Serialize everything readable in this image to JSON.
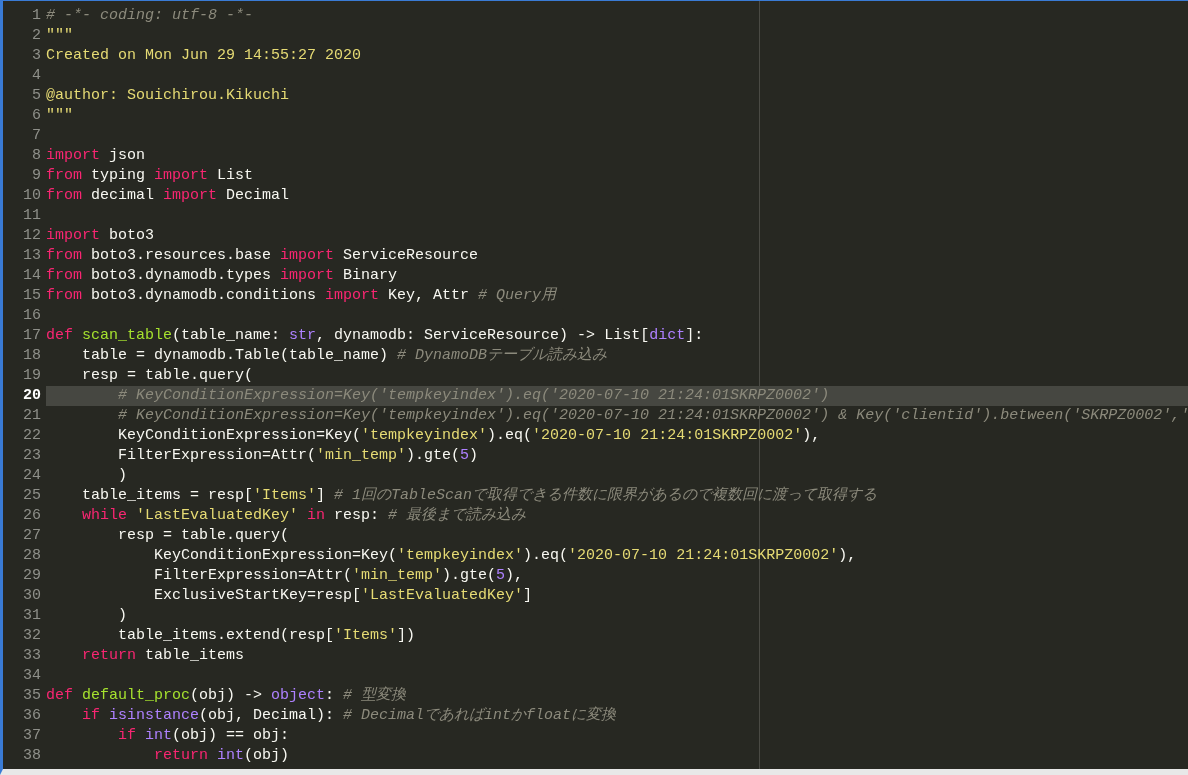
{
  "editor": {
    "lines": [
      {
        "number": "1",
        "current": false,
        "tokens": [
          {
            "kind": "comment",
            "text": "# -*- coding: utf-8 -*-"
          }
        ]
      },
      {
        "number": "2",
        "current": false,
        "tokens": [
          {
            "kind": "string",
            "text": "\"\"\""
          }
        ]
      },
      {
        "number": "3",
        "current": false,
        "tokens": [
          {
            "kind": "string",
            "text": "Created on Mon Jun 29 14:55:27 2020"
          }
        ]
      },
      {
        "number": "4",
        "current": false
      },
      {
        "number": "5",
        "current": false,
        "tokens": [
          {
            "kind": "string",
            "text": "@author: Souichirou.Kikuchi"
          }
        ]
      },
      {
        "number": "6",
        "current": false,
        "tokens": [
          {
            "kind": "string",
            "text": "\"\"\""
          }
        ]
      },
      {
        "number": "7",
        "current": false
      },
      {
        "number": "8",
        "current": false,
        "tokens": [
          {
            "kind": "keyword",
            "text": "import"
          },
          {
            "kind": "plain",
            "text": " json"
          }
        ]
      },
      {
        "number": "9",
        "current": false,
        "tokens": [
          {
            "kind": "keyword",
            "text": "from"
          },
          {
            "kind": "plain",
            "text": " typing "
          },
          {
            "kind": "keyword",
            "text": "import"
          },
          {
            "kind": "plain",
            "text": " List"
          }
        ]
      },
      {
        "number": "10",
        "current": false,
        "tokens": [
          {
            "kind": "keyword",
            "text": "from"
          },
          {
            "kind": "plain",
            "text": " decimal "
          },
          {
            "kind": "keyword",
            "text": "import"
          },
          {
            "kind": "plain",
            "text": " Decimal"
          }
        ]
      },
      {
        "number": "11",
        "current": false
      },
      {
        "number": "12",
        "current": false,
        "tokens": [
          {
            "kind": "keyword",
            "text": "import"
          },
          {
            "kind": "plain",
            "text": " boto3"
          }
        ]
      },
      {
        "number": "13",
        "current": false,
        "tokens": [
          {
            "kind": "keyword",
            "text": "from"
          },
          {
            "kind": "plain",
            "text": " boto3.resources.base "
          },
          {
            "kind": "keyword",
            "text": "import"
          },
          {
            "kind": "plain",
            "text": " ServiceResource"
          }
        ]
      },
      {
        "number": "14",
        "current": false,
        "tokens": [
          {
            "kind": "keyword",
            "text": "from"
          },
          {
            "kind": "plain",
            "text": " boto3.dynamodb.types "
          },
          {
            "kind": "keyword",
            "text": "import"
          },
          {
            "kind": "plain",
            "text": " Binary"
          }
        ]
      },
      {
        "number": "15",
        "current": false,
        "tokens": [
          {
            "kind": "keyword",
            "text": "from"
          },
          {
            "kind": "plain",
            "text": " boto3.dynamodb.conditions "
          },
          {
            "kind": "keyword",
            "text": "import"
          },
          {
            "kind": "plain",
            "text": " Key, Attr "
          },
          {
            "kind": "comment",
            "text": "# Query用"
          }
        ]
      },
      {
        "number": "16",
        "current": false
      },
      {
        "number": "17",
        "current": false,
        "tokens": [
          {
            "kind": "keyword",
            "text": "def "
          },
          {
            "kind": "function",
            "text": "scan_table"
          },
          {
            "kind": "plain",
            "text": "(table_name: "
          },
          {
            "kind": "builtin",
            "text": "str"
          },
          {
            "kind": "plain",
            "text": ", dynamodb: ServiceResource) -> List["
          },
          {
            "kind": "builtin",
            "text": "dict"
          },
          {
            "kind": "plain",
            "text": "]:"
          }
        ]
      },
      {
        "number": "18",
        "current": false,
        "tokens": [
          {
            "kind": "plain",
            "text": "    table = dynamodb.Table(table_name) "
          },
          {
            "kind": "comment",
            "text": "# DynamoDBテーブル読み込み"
          }
        ]
      },
      {
        "number": "19",
        "current": false,
        "tokens": [
          {
            "kind": "plain",
            "text": "    resp = table.query("
          }
        ]
      },
      {
        "number": "20",
        "current": true,
        "tokens": [
          {
            "kind": "comment",
            "text": "        # KeyConditionExpression=Key('tempkeyindex').eq('2020-07-10 21:24:01SKRPZ0002')"
          }
        ]
      },
      {
        "number": "21",
        "current": false,
        "tokens": [
          {
            "kind": "comment",
            "text": "        # KeyConditionExpression=Key('tempkeyindex').eq('2020-07-10 21:24:01SKRPZ0002') & Key('clientid').between('SKRPZ0002','"
          }
        ]
      },
      {
        "number": "22",
        "current": false,
        "tokens": [
          {
            "kind": "plain",
            "text": "        KeyConditionExpression=Key("
          },
          {
            "kind": "string",
            "text": "'tempkeyindex'"
          },
          {
            "kind": "plain",
            "text": ").eq("
          },
          {
            "kind": "string",
            "text": "'2020-07-10 21:24:01SKRPZ0002'"
          },
          {
            "kind": "plain",
            "text": "),"
          }
        ]
      },
      {
        "number": "23",
        "current": false,
        "tokens": [
          {
            "kind": "plain",
            "text": "        FilterExpression=Attr("
          },
          {
            "kind": "string",
            "text": "'min_temp'"
          },
          {
            "kind": "plain",
            "text": ").gte("
          },
          {
            "kind": "builtin",
            "text": "5"
          },
          {
            "kind": "plain",
            "text": ")"
          }
        ]
      },
      {
        "number": "24",
        "current": false,
        "tokens": [
          {
            "kind": "plain",
            "text": "        )"
          }
        ]
      },
      {
        "number": "25",
        "current": false,
        "tokens": [
          {
            "kind": "plain",
            "text": "    table_items = resp["
          },
          {
            "kind": "string",
            "text": "'Items'"
          },
          {
            "kind": "plain",
            "text": "] "
          },
          {
            "kind": "comment",
            "text": "# 1回のTableScanで取得できる件数に限界があるので複数回に渡って取得する"
          }
        ]
      },
      {
        "number": "26",
        "current": false,
        "tokens": [
          {
            "kind": "keyword",
            "text": "    while "
          },
          {
            "kind": "string",
            "text": "'LastEvaluatedKey'"
          },
          {
            "kind": "keyword",
            "text": " in"
          },
          {
            "kind": "plain",
            "text": " resp: "
          },
          {
            "kind": "comment",
            "text": "# 最後まで読み込み"
          }
        ]
      },
      {
        "number": "27",
        "current": false,
        "tokens": [
          {
            "kind": "plain",
            "text": "        resp = table.query("
          }
        ]
      },
      {
        "number": "28",
        "current": false,
        "tokens": [
          {
            "kind": "plain",
            "text": "            KeyConditionExpression=Key("
          },
          {
            "kind": "string",
            "text": "'tempkeyindex'"
          },
          {
            "kind": "plain",
            "text": ").eq("
          },
          {
            "kind": "string",
            "text": "'2020-07-10 21:24:01SKRPZ0002'"
          },
          {
            "kind": "plain",
            "text": "),"
          }
        ]
      },
      {
        "number": "29",
        "current": false,
        "tokens": [
          {
            "kind": "plain",
            "text": "            FilterExpression=Attr("
          },
          {
            "kind": "string",
            "text": "'min_temp'"
          },
          {
            "kind": "plain",
            "text": ").gte("
          },
          {
            "kind": "builtin",
            "text": "5"
          },
          {
            "kind": "plain",
            "text": "),"
          }
        ]
      },
      {
        "number": "30",
        "current": false,
        "tokens": [
          {
            "kind": "plain",
            "text": "            ExclusiveStartKey=resp["
          },
          {
            "kind": "string",
            "text": "'LastEvaluatedKey'"
          },
          {
            "kind": "plain",
            "text": "]"
          }
        ]
      },
      {
        "number": "31",
        "current": false,
        "tokens": [
          {
            "kind": "plain",
            "text": "        )"
          }
        ]
      },
      {
        "number": "32",
        "current": false,
        "tokens": [
          {
            "kind": "plain",
            "text": "        table_items.extend(resp["
          },
          {
            "kind": "string",
            "text": "'Items'"
          },
          {
            "kind": "plain",
            "text": "])"
          }
        ]
      },
      {
        "number": "33",
        "current": false,
        "tokens": [
          {
            "kind": "keyword",
            "text": "    return"
          },
          {
            "kind": "plain",
            "text": " table_items"
          }
        ]
      },
      {
        "number": "34",
        "current": false
      },
      {
        "number": "35",
        "current": false,
        "tokens": [
          {
            "kind": "keyword",
            "text": "def "
          },
          {
            "kind": "function",
            "text": "default_proc"
          },
          {
            "kind": "plain",
            "text": "(obj) -> "
          },
          {
            "kind": "builtin",
            "text": "object"
          },
          {
            "kind": "plain",
            "text": ": "
          },
          {
            "kind": "comment",
            "text": "# 型変換"
          }
        ]
      },
      {
        "number": "36",
        "current": false,
        "tokens": [
          {
            "kind": "keyword",
            "text": "    if "
          },
          {
            "kind": "builtin",
            "text": "isinstance"
          },
          {
            "kind": "plain",
            "text": "(obj, Decimal): "
          },
          {
            "kind": "comment",
            "text": "# Decimalであればintかfloatに変換"
          }
        ]
      },
      {
        "number": "37",
        "current": false,
        "tokens": [
          {
            "kind": "keyword",
            "text": "        if "
          },
          {
            "kind": "builtin",
            "text": "int"
          },
          {
            "kind": "plain",
            "text": "(obj) == obj:"
          }
        ]
      },
      {
        "number": "38",
        "current": false,
        "tokens": [
          {
            "kind": "keyword",
            "text": "            return "
          },
          {
            "kind": "builtin",
            "text": "int"
          },
          {
            "kind": "plain",
            "text": "(obj)"
          }
        ]
      }
    ]
  }
}
